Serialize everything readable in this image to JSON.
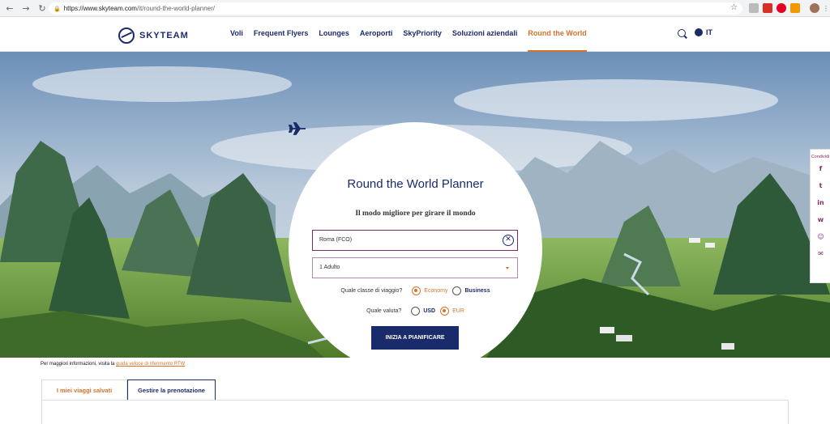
{
  "browser": {
    "url_domain": "https://www.skyteam.com",
    "url_path": "/it/round-the-world-planner/",
    "back": "←",
    "forward": "→",
    "reload": "↻",
    "lock": "🔒",
    "star": "☆"
  },
  "header": {
    "logo_text": "SKYTEAM",
    "nav": [
      "Voli",
      "Frequent Flyers",
      "Lounges",
      "Aeroporti",
      "SkyPriority",
      "Soluzioni aziendali",
      "Round the World"
    ],
    "active_nav": "Round the World",
    "language": "IT"
  },
  "planner": {
    "title": "Round the World Planner",
    "subtitle": "Il modo migliore per girare il mondo",
    "origin_value": "Roma (FCO)",
    "passengers_value": "1 Adulto",
    "class_question": "Quale classe di viaggio?",
    "class_options": [
      "Economy",
      "Business"
    ],
    "class_selected": "Economy",
    "currency_question": "Quale valuta?",
    "currency_options": [
      "USD",
      "EUR"
    ],
    "currency_selected": "EUR",
    "cta": "INIZIA A PIANIFICARE",
    "clear_glyph": "✕"
  },
  "share": {
    "label": "Condividi",
    "icons": [
      "facebook-icon",
      "twitter-icon",
      "linkedin-icon",
      "weibo-icon",
      "wechat-icon",
      "email-icon"
    ],
    "glyphs": [
      "f",
      "t",
      "in",
      "w",
      "☺",
      "✉"
    ]
  },
  "info": {
    "text": "Per maggiori informazioni, visita la",
    "link": "guida veloce di riferimento RTW"
  },
  "tabs": [
    "I miei viaggi salvati",
    "Gestire la prenotazione"
  ],
  "colors": {
    "brand_navy": "#1a2b6b",
    "accent_orange": "#d5732b",
    "purple": "#7a2a6a"
  }
}
